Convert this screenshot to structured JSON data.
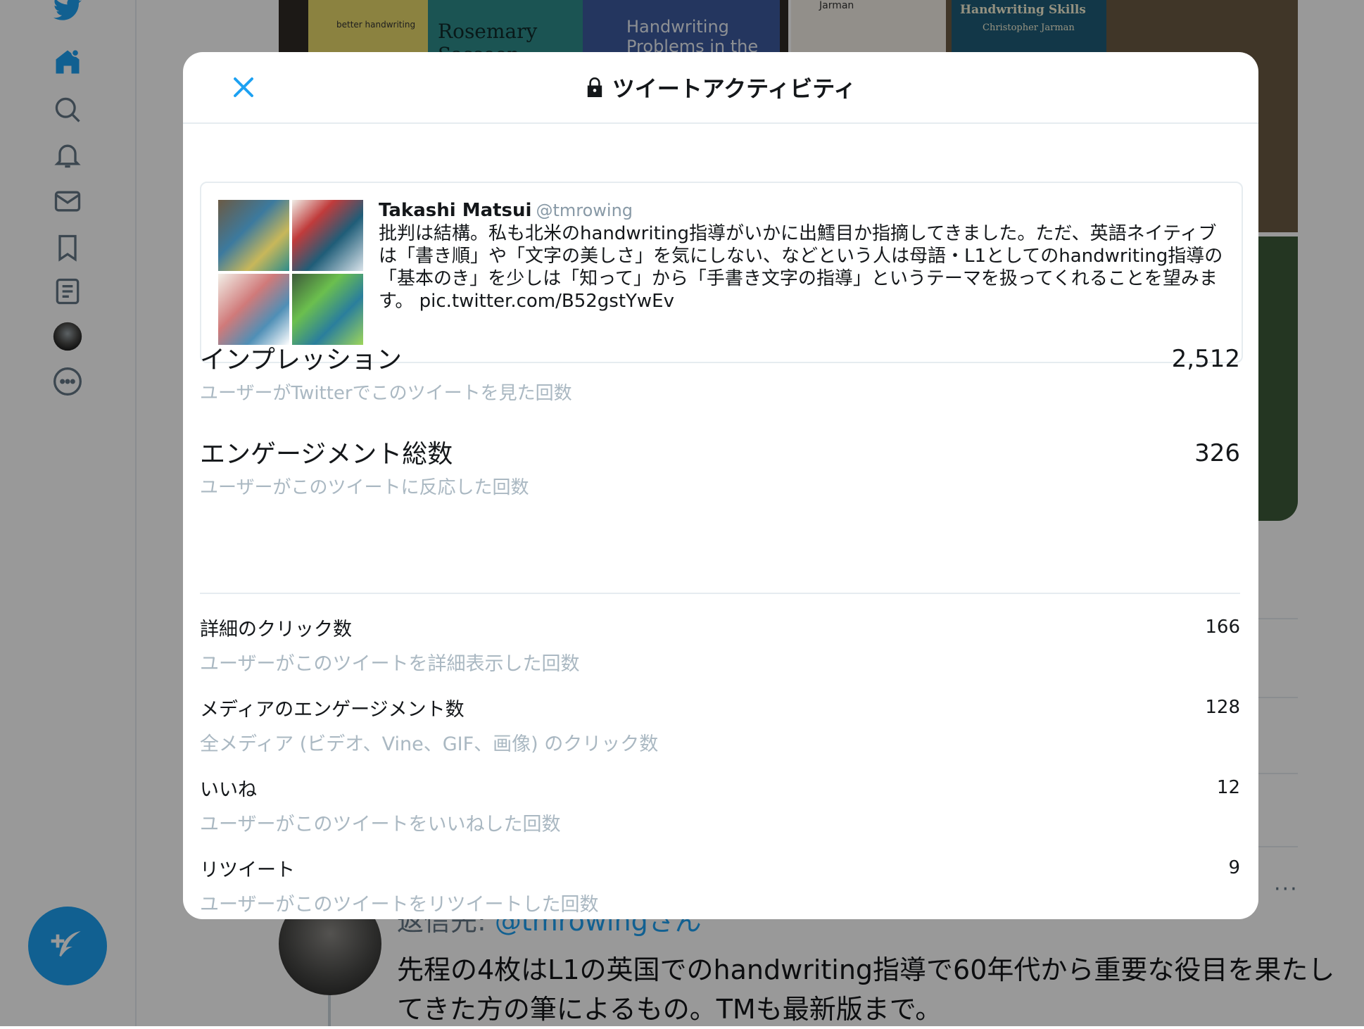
{
  "background": {
    "books": {
      "left_book_small": "better handwriting",
      "left_book_author": "Rosemary Sassoon",
      "left_book_title": "Handwriting Problems in the",
      "right_book_author": "Jarman",
      "right_book_title": "Handwriting Skills",
      "right_book_subtitle": "Christopher Jarman"
    },
    "reply_prefix": "返信先: ",
    "reply_mention": "@tmrowingさん",
    "tweet_text": "先程の4枚はL1の英国でのhandwriting指導で60年代から重要な役目を果たしてきた方の筆によるもの。TMも最新版まで。",
    "more": "···"
  },
  "modal": {
    "title": "ツイートアクティビティ",
    "tweet": {
      "name": "Takashi Matsui",
      "handle": "@tmrowing",
      "text": "批判は結構。私も北米のhandwriting指導がいかに出鱈目か指摘してきました。ただ、英語ネイティブは「書き順」や「文字の美しさ」を気にしない、などという人は母語・L1としてのhandwriting指導の「基本のき」を少しは「知って」から「手書き文字の指導」というテーマを扱ってくれることを望みます。 pic.twitter.com/B52gstYwEv"
    },
    "metrics": [
      {
        "label": "インプレッション",
        "sub": "ユーザーがTwitterでこのツイートを見た回数",
        "value": "2,512"
      },
      {
        "label": "エンゲージメント総数",
        "sub": "ユーザーがこのツイートに反応した回数",
        "value": "326"
      }
    ],
    "details": [
      {
        "label": "詳細のクリック数",
        "sub": "ユーザーがこのツイートを詳細表示した回数",
        "value": "166"
      },
      {
        "label": "メディアのエンゲージメント数",
        "sub": "全メディア (ビデオ、Vine、GIF、画像) のクリック数",
        "value": "128"
      },
      {
        "label": "いいね",
        "sub": "ユーザーがこのツイートをいいねした回数",
        "value": "12"
      },
      {
        "label": "リツイート",
        "sub": "ユーザーがこのツイートをリツイートした回数",
        "value": "9"
      }
    ]
  },
  "colors": {
    "accent": "#1da1f2",
    "muted": "#aab8c2",
    "text": "#14171a"
  }
}
